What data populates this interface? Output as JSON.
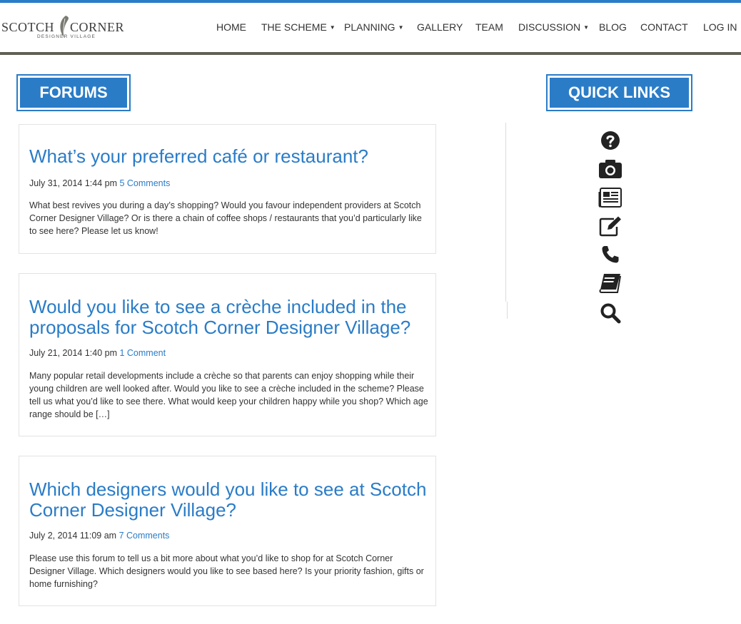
{
  "site": {
    "logo": {
      "word1": "SCOTCH",
      "word2": "CORNER",
      "tagline": "DESIGNER  VILLAGE"
    }
  },
  "nav": {
    "items": [
      {
        "label": "HOME",
        "dropdown": false
      },
      {
        "label": "THE SCHEME",
        "dropdown": true
      },
      {
        "label": "PLANNING",
        "dropdown": true
      },
      {
        "label": "GALLERY",
        "dropdown": false
      },
      {
        "label": "TEAM",
        "dropdown": false
      },
      {
        "label": "DISCUSSION",
        "dropdown": true
      },
      {
        "label": "BLOG",
        "dropdown": false
      },
      {
        "label": "CONTACT",
        "dropdown": false
      },
      {
        "label": "LOG IN",
        "dropdown": false
      }
    ],
    "caret": "▼"
  },
  "main": {
    "heading": "FORUMS",
    "posts": [
      {
        "title": "What’s your preferred café or restaurant?",
        "date": "July 31, 2014 1:44 pm",
        "comments": "5 Comments",
        "excerpt": "What best revives you during a day’s shopping?  Would you favour independent providers at Scotch Corner Designer Village?  Or is there a chain of coffee shops / restaurants that you’d particularly like to see here?  Please let us know!"
      },
      {
        "title": "Would you like to see a crèche included in the proposals for Scotch Corner Designer Village?",
        "date": "July 21, 2014 1:40 pm",
        "comments": "1 Comment",
        "excerpt": "Many popular retail developments include a crèche so that parents can enjoy shopping while their young children are well looked after.  Would you like to see a crèche included in the scheme?  Please tell us what you’d like to see there.  What would keep your children happy while you shop?  Which age range should be […]"
      },
      {
        "title": "Which designers would you like to see at Scotch Corner Designer Village?",
        "date": "July 2, 2014 11:09 am",
        "comments": "7 Comments",
        "excerpt": "Please use this forum to tell us a bit more about what you’d like to shop for at Scotch Corner Designer Village. Which designers would you like to see based here? Is your priority fashion, gifts or home furnishing?"
      }
    ]
  },
  "sidebar": {
    "heading": "QUICK LINKS",
    "links": [
      {
        "icon": "question-circle-icon"
      },
      {
        "icon": "camera-icon"
      },
      {
        "icon": "newspaper-icon"
      },
      {
        "icon": "edit-icon"
      },
      {
        "icon": "phone-icon"
      },
      {
        "icon": "book-icon"
      },
      {
        "icon": "search-icon"
      }
    ]
  },
  "colors": {
    "accent": "#2a7cc7",
    "topbar": "#2a7cc7",
    "header_rule": "#5f5f55",
    "icon": "#222222"
  }
}
